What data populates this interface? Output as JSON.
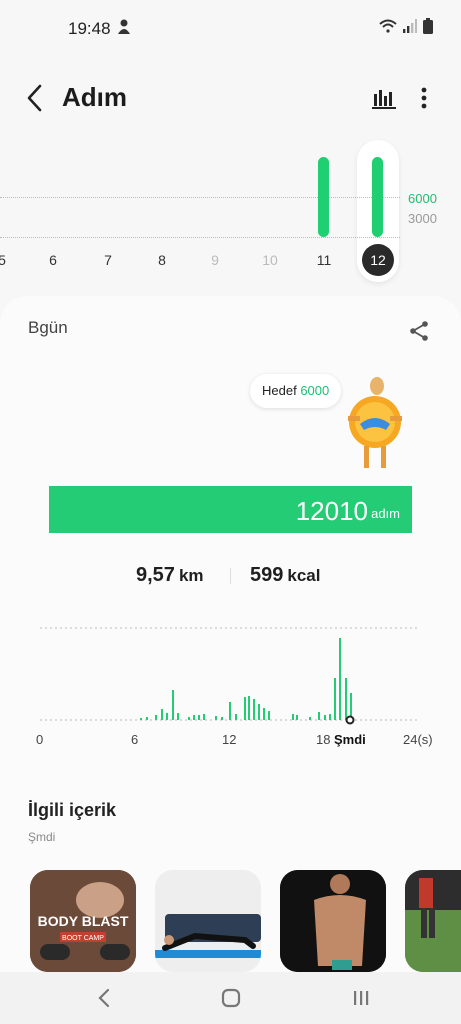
{
  "status": {
    "time": "19:48"
  },
  "appbar": {
    "title": "Adım"
  },
  "day_strip": {
    "goal_label": "6000",
    "mid_label": "3000",
    "days": [
      {
        "label": "5",
        "muted": false
      },
      {
        "label": "6",
        "muted": false
      },
      {
        "label": "7",
        "muted": false
      },
      {
        "label": "8",
        "muted": false
      },
      {
        "label": "9",
        "muted": true
      },
      {
        "label": "10",
        "muted": true
      },
      {
        "label": "11",
        "muted": false
      },
      {
        "label": "12",
        "muted": false,
        "selected": true
      }
    ]
  },
  "card": {
    "today": "Bgün",
    "goal_prefix": "Hedef",
    "goal_value": "6000",
    "steps": "12010",
    "steps_unit": "adım",
    "distance": "9,57",
    "distance_unit": "km",
    "calories": "599",
    "calories_unit": "kcal"
  },
  "hourly_axis": [
    "0",
    "6",
    "12",
    "18",
    "Şmdi",
    "24(s)"
  ],
  "related": {
    "title": "İlgili içerik",
    "subtitle": "Şmdi"
  },
  "thumbs": [
    {
      "title": "BODY BLAST",
      "subtitle": "BOOT CAMP"
    }
  ],
  "colors": {
    "accent": "#25cc76",
    "goal_text": "#1dbf73"
  }
}
